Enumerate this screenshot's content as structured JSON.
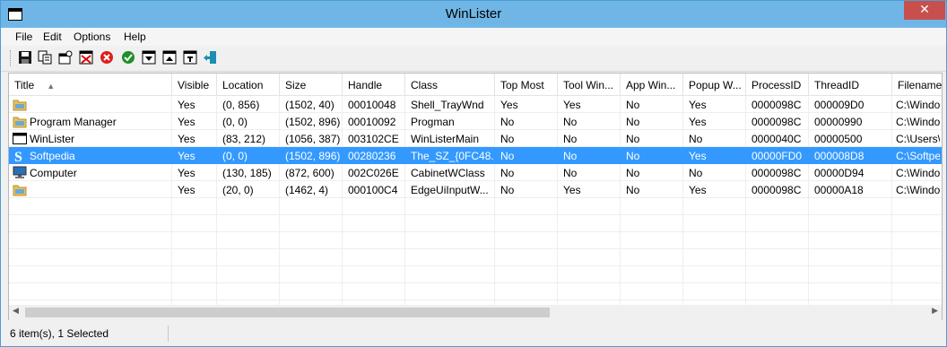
{
  "window": {
    "title": "WinLister",
    "close_glyph": "✕"
  },
  "menu": [
    "File",
    "Edit",
    "Options",
    "Help"
  ],
  "toolbar": {
    "icons": [
      "save-icon",
      "copy-icon",
      "properties-icon",
      "close-window-icon",
      "stop-icon",
      "check-icon",
      "minimize-window-icon",
      "maximize-window-icon",
      "restore-window-icon",
      "exit-icon"
    ]
  },
  "columns": [
    "Title",
    "Visible",
    "Location",
    "Size",
    "Handle",
    "Class",
    "Top Most",
    "Tool Win...",
    "App Win...",
    "Popup W...",
    "ProcessID",
    "ThreadID",
    "Filename"
  ],
  "sort_glyph": "▲",
  "rows": [
    {
      "icon": "folder-icon",
      "cells": [
        "",
        "Yes",
        "(0, 856)",
        "(1502, 40)",
        "00010048",
        "Shell_TrayWnd",
        "Yes",
        "Yes",
        "No",
        "Yes",
        "0000098C",
        "000009D0",
        "C:\\Windo"
      ],
      "selected": false
    },
    {
      "icon": "folder-icon",
      "cells": [
        "Program Manager",
        "Yes",
        "(0, 0)",
        "(1502, 896)",
        "00010092",
        "Progman",
        "No",
        "No",
        "No",
        "Yes",
        "0000098C",
        "00000990",
        "C:\\Windo"
      ],
      "selected": false
    },
    {
      "icon": "window-icon",
      "cells": [
        "WinLister",
        "Yes",
        "(83, 212)",
        "(1056, 387)",
        "003102CE",
        "WinListerMain",
        "No",
        "No",
        "No",
        "No",
        "0000040C",
        "00000500",
        "C:\\Users\\"
      ],
      "selected": false
    },
    {
      "icon": "softpedia-icon",
      "cells": [
        "Softpedia",
        "Yes",
        "(0, 0)",
        "(1502, 896)",
        "00280236",
        "The_SZ_{0FC48...",
        "No",
        "No",
        "No",
        "Yes",
        "00000FD0",
        "000008D8",
        "C:\\Softpe"
      ],
      "selected": true
    },
    {
      "icon": "computer-icon",
      "cells": [
        "Computer",
        "Yes",
        "(130, 185)",
        "(872, 600)",
        "002C026E",
        "CabinetWClass",
        "No",
        "No",
        "No",
        "No",
        "0000098C",
        "00000D94",
        "C:\\Windo"
      ],
      "selected": false
    },
    {
      "icon": "folder-icon",
      "cells": [
        "",
        "Yes",
        "(20, 0)",
        "(1462, 4)",
        "000100C4",
        "EdgeUiInputW...",
        "No",
        "Yes",
        "No",
        "Yes",
        "0000098C",
        "00000A18",
        "C:\\Windo"
      ],
      "selected": false
    }
  ],
  "scroll": {
    "left_glyph": "◀",
    "right_glyph": "▶"
  },
  "status": {
    "text": "6 item(s), 1 Selected"
  },
  "colors": {
    "titlebar": "#6fb6e6",
    "close": "#c7504c",
    "selection": "#3399ff"
  }
}
